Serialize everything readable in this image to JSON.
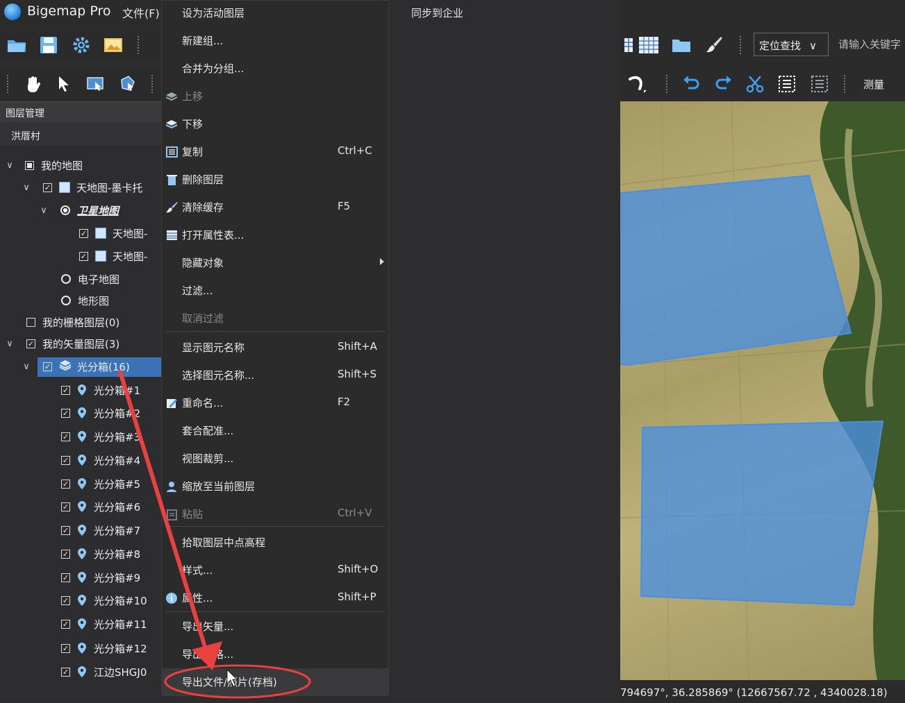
{
  "app": {
    "title": "Bigemap Pro",
    "menu_file": "文件(F)"
  },
  "panel": {
    "title": "图层管理",
    "project": "洪厝村"
  },
  "tree": {
    "my_map": "我的地图",
    "tianditu": "天地图-墨卡托",
    "satellite": "卫星地图",
    "sat_sub1": "天地图-",
    "sat_sub2": "天地图-",
    "electronic": "电子地图",
    "terrain": "地形图",
    "raster": "我的栅格图层(0)",
    "vector": "我的矢量图层(3)",
    "group": "光分箱(16)",
    "items": [
      "光分箱#1",
      "光分箱#2",
      "光分箱#3",
      "光分箱#4",
      "光分箱#5",
      "光分箱#6",
      "光分箱#7",
      "光分箱#8",
      "光分箱#9",
      "光分箱#10",
      "光分箱#11",
      "光分箱#12",
      "江边SHGJ0"
    ]
  },
  "menu": [
    {
      "label": "设为活动图层",
      "shortcut": "",
      "icon": "",
      "disabled": false
    },
    {
      "label": "新建组...",
      "shortcut": "",
      "icon": "",
      "disabled": false
    },
    {
      "label": "合并为分组...",
      "shortcut": "",
      "icon": "",
      "disabled": false
    },
    {
      "label": "上移",
      "shortcut": "",
      "icon": "layers-up-icon",
      "disabled": true
    },
    {
      "label": "下移",
      "shortcut": "",
      "icon": "layers-down-icon",
      "disabled": false
    },
    {
      "label": "复制",
      "shortcut": "Ctrl+C",
      "icon": "copy-icon",
      "disabled": false
    },
    {
      "label": "删除图层",
      "shortcut": "",
      "icon": "trash-icon",
      "disabled": false
    },
    {
      "label": "清除缓存",
      "shortcut": "F5",
      "icon": "brush-icon",
      "disabled": false
    },
    {
      "label": "打开属性表...",
      "shortcut": "",
      "icon": "table-icon",
      "disabled": false
    },
    {
      "label": "隐藏对象",
      "shortcut": "",
      "icon": "",
      "disabled": false,
      "submenu": true
    },
    {
      "label": "过滤...",
      "shortcut": "",
      "icon": "",
      "disabled": false
    },
    {
      "label": "取消过滤",
      "shortcut": "",
      "icon": "",
      "disabled": true
    },
    {
      "label": "显示图元名称",
      "shortcut": "Shift+A",
      "icon": "",
      "disabled": false
    },
    {
      "label": "选择图元名称...",
      "shortcut": "Shift+S",
      "icon": "",
      "disabled": false
    },
    {
      "label": "重命名...",
      "shortcut": "F2",
      "icon": "pencil-icon",
      "disabled": false
    },
    {
      "label": "套合配准...",
      "shortcut": "",
      "icon": "",
      "disabled": false
    },
    {
      "label": "视图裁剪...",
      "shortcut": "",
      "icon": "",
      "disabled": false
    },
    {
      "label": "缩放至当前图层",
      "shortcut": "",
      "icon": "zoom-layer-icon",
      "disabled": false
    },
    {
      "label": "粘贴",
      "shortcut": "Ctrl+V",
      "icon": "paste-icon",
      "disabled": true
    },
    {
      "label": "拾取图层中点高程",
      "shortcut": "",
      "icon": "",
      "disabled": false
    },
    {
      "label": "样式...",
      "shortcut": "Shift+O",
      "icon": "",
      "disabled": false
    },
    {
      "label": "属性...",
      "shortcut": "Shift+P",
      "icon": "info-icon",
      "disabled": false
    },
    {
      "label": "导出矢量...",
      "shortcut": "",
      "icon": "",
      "disabled": false
    },
    {
      "label": "导出栅格...",
      "shortcut": "",
      "icon": "",
      "disabled": false
    },
    {
      "label": "导出文件/照片(存档)",
      "shortcut": "",
      "icon": "",
      "disabled": false,
      "highlight": true
    }
  ],
  "sync_enterprise": "同步到企业",
  "right_toolbar": {
    "locate": "定位查找",
    "search_placeholder": "请输入关键字",
    "measure": "测量"
  },
  "status": {
    "coords": "794697°, 36.285869°  (12667567.72 , 4340028.18)"
  },
  "colors": {
    "accent": "#3b73b6",
    "annotation": "#e8413f",
    "polygon_fill": "#4a8fe0"
  }
}
